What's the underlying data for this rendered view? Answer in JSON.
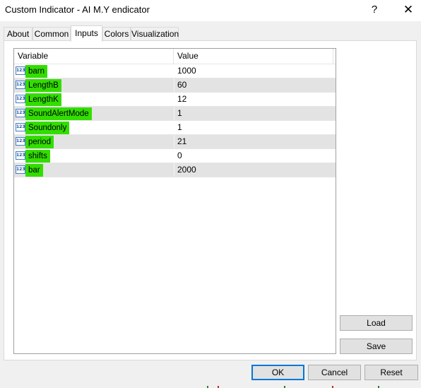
{
  "window": {
    "title": "Custom Indicator - AI M.Y endicator",
    "help_glyph": "?",
    "close_glyph": "✕"
  },
  "tabs": [
    "About",
    "Common",
    "Inputs",
    "Colors",
    "Visualization"
  ],
  "active_tab": "Inputs",
  "grid": {
    "columns": [
      "Variable",
      "Value"
    ],
    "icon_text": "123",
    "rows": [
      {
        "variable": "barn",
        "value": "1000"
      },
      {
        "variable": "LengthB",
        "value": "60"
      },
      {
        "variable": "LengthK",
        "value": "12"
      },
      {
        "variable": "SoundAlertMode",
        "value": "1"
      },
      {
        "variable": "Soundonly",
        "value": "1"
      },
      {
        "variable": "period",
        "value": "21"
      },
      {
        "variable": "shifts",
        "value": "0"
      },
      {
        "variable": "bar",
        "value": "2000"
      }
    ]
  },
  "side_buttons": {
    "load": "Load",
    "save": "Save"
  },
  "footer_buttons": {
    "ok": "OK",
    "cancel": "Cancel",
    "reset": "Reset"
  },
  "colors": {
    "highlight": "#33dd00",
    "accent": "#0078d7"
  }
}
